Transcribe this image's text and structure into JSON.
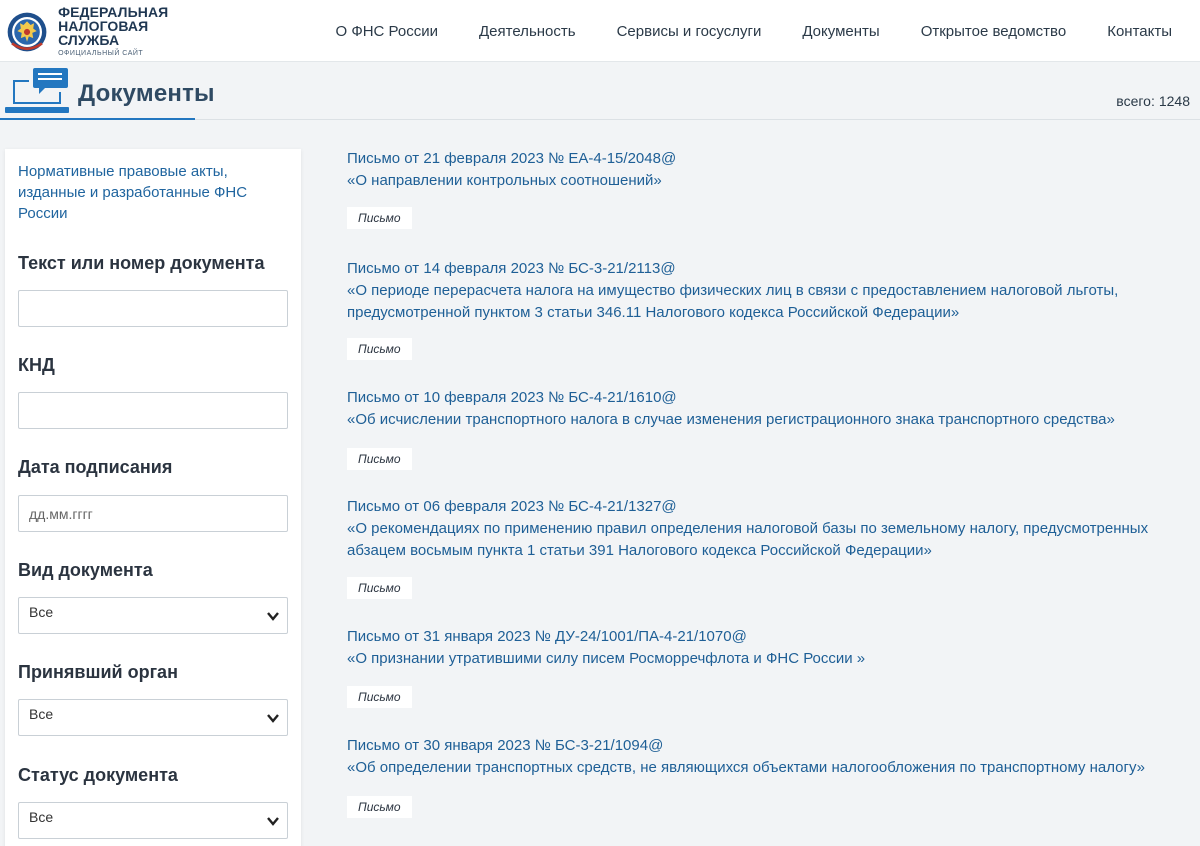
{
  "header": {
    "logo_line1": "ФЕДЕРАЛЬНАЯ",
    "logo_line2": "НАЛОГОВАЯ СЛУЖБА",
    "logo_line3": "ОФИЦИАЛЬНЫЙ САЙТ",
    "nav": [
      "О ФНС России",
      "Деятельность",
      "Сервисы и госуслуги",
      "Документы",
      "Открытое ведомство",
      "Контакты"
    ]
  },
  "page": {
    "title": "Документы",
    "total_label": "всего:",
    "total_value": "1248"
  },
  "sidebar": {
    "section_link": "Нормативные правовые акты, изданные и разработанные ФНС России",
    "text_label": "Текст или номер документа",
    "text_value": "",
    "knd_label": "КНД",
    "knd_value": "",
    "date_label": "Дата подписания",
    "date_placeholder": "дд.мм.гггг",
    "doctype_label": "Вид документа",
    "doctype_value": "Все",
    "agency_label": "Принявший орган",
    "agency_value": "Все",
    "status_label": "Статус документа",
    "status_value": "Все"
  },
  "documents": [
    {
      "line1": "Письмо от 21 февраля 2023 № ЕА-4-15/2048@",
      "line2": "«О направлении контрольных соотношений»",
      "line3": "",
      "type": "Письмо"
    },
    {
      "line1": "Письмо от 14 февраля 2023 № БС-3-21/2113@",
      "line2": "«О периоде перерасчета налога на имущество физических лиц в связи с предоставлением налоговой льготы,",
      "line3": "предусмотренной пунктом 3 статьи 346.11 Налогового кодекса Российской Федерации»",
      "type": "Письмо"
    },
    {
      "line1": "Письмо от 10 февраля 2023 № БС-4-21/1610@",
      "line2": "«Об исчислении транспортного налога в случае изменения регистрационного знака транспортного средства»",
      "line3": "",
      "type": "Письмо"
    },
    {
      "line1": "Письмо от 06 февраля 2023 № БС-4-21/1327@",
      "line2": "«О рекомендациях по применению правил определения налоговой базы по земельному налогу, предусмотренных",
      "line3": "абзацем восьмым пункта 1 статьи 391 Налогового кодекса Российской Федерации»",
      "type": "Письмо"
    },
    {
      "line1": "Письмо от 31 января 2023 № ДУ-24/1001/ПА-4-21/1070@",
      "line2": "«О признании утратившими силу писем Росморречфлота и ФНС России »",
      "line3": "",
      "type": "Письмо"
    },
    {
      "line1": "Письмо от 30 января 2023 № БС-3-21/1094@",
      "line2": "«Об определении транспортных средств, не являющихся объектами налогообложения по транспортному налогу»",
      "line3": "",
      "type": "Письмо"
    }
  ]
}
